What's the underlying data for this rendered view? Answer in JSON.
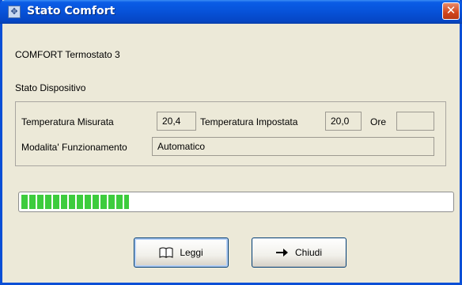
{
  "window": {
    "title": "Stato Comfort",
    "close_glyph": "✕"
  },
  "main": {
    "heading": "COMFORT Termostato 3"
  },
  "device_status": {
    "group_label": "Stato Dispositivo",
    "measured_temp_label": "Temperatura Misurata",
    "measured_temp_value": "20,4",
    "set_temp_label": "Temperatura Impostata",
    "set_temp_value": "20,0",
    "hours_label": "Ore",
    "hours_value": "",
    "mode_label": "Modalita' Funzionamento",
    "mode_value": "Automatico"
  },
  "progress": {
    "value": 0.25,
    "color": "#3dcc3d"
  },
  "buttons": {
    "read_label": "Leggi",
    "read_icon": "book-icon",
    "close_label": "Chiudi",
    "close_icon": "arrow-right-icon"
  },
  "colors": {
    "titlebar": "#0752d8",
    "window_bg": "#ece9d8",
    "close_button": "#d2461c"
  }
}
